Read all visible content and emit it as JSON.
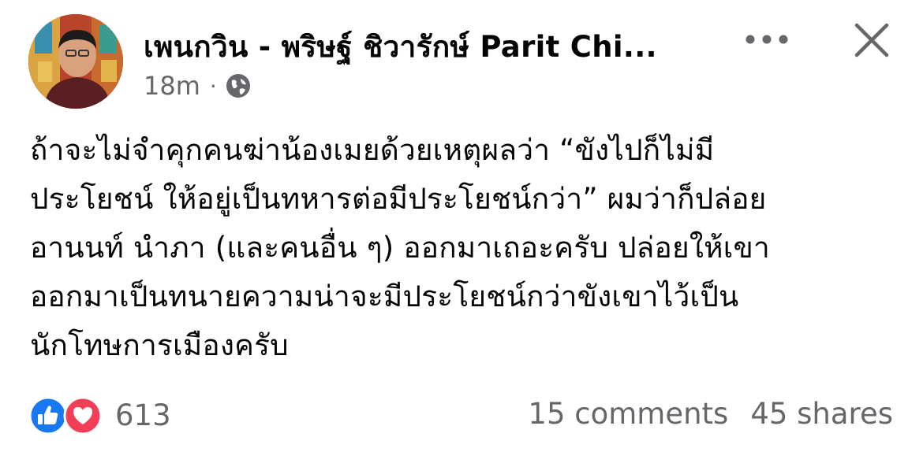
{
  "post": {
    "author_name": "เพนกวิน - พริษฐ์ ชิวารักษ์ Parit Chi...",
    "timestamp": "18m",
    "separator": "·",
    "audience_icon": "globe-icon",
    "body": "ถ้าจะไม่จำคุกคนฆ่าน้องเมยด้วยเหตุผลว่า “ขังไปก็ไม่มี\nประโยชน์ ให้อยู่เป็นทหารต่อมีประโยชน์กว่า” ผมว่าก็ปล่อย\nอานนท์ นำภา (และคนอื่น ๆ) ออกมาเถอะครับ ปล่อยให้เขา\nออกมาเป็นทนายความน่าจะมีประโยชน์กว่าขังเขาไว้เป็น\nนักโทษการเมืองครับ"
  },
  "header_actions": {
    "more_icon": "more-horizontal-icon",
    "close_icon": "close-icon"
  },
  "reactions": {
    "types": [
      "like",
      "love"
    ],
    "count": "613",
    "like_color": "#1877f2",
    "love_color": "#f33e58"
  },
  "stats": {
    "comments": "15 comments",
    "shares": "45 shares"
  }
}
